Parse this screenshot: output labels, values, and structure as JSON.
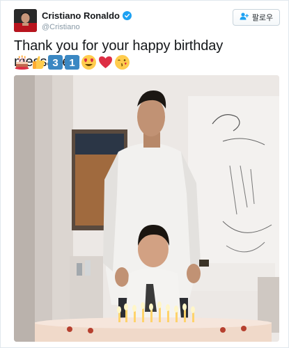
{
  "user": {
    "name": "Cristiano Ronaldo",
    "handle": "@Cristiano",
    "verified": true
  },
  "follow_button": {
    "label": "팔로우",
    "icon": "follow-user-icon"
  },
  "tweet": {
    "text": "Thank you for your happy birthday messages!",
    "emojis": [
      "birthday-cake",
      "thumbs-up",
      "keycap-3",
      "keycap-1",
      "heart-eyes-face",
      "red-heart",
      "kissing-face"
    ],
    "keycap_labels": [
      "3",
      "1"
    ]
  },
  "photo": {
    "subject": "birthday-photo"
  },
  "colors": {
    "verified": "#1da1f2",
    "keycap": "#3b88c3",
    "heart": "#dd2e44",
    "emoji_yellow": "#ffcc4d"
  }
}
